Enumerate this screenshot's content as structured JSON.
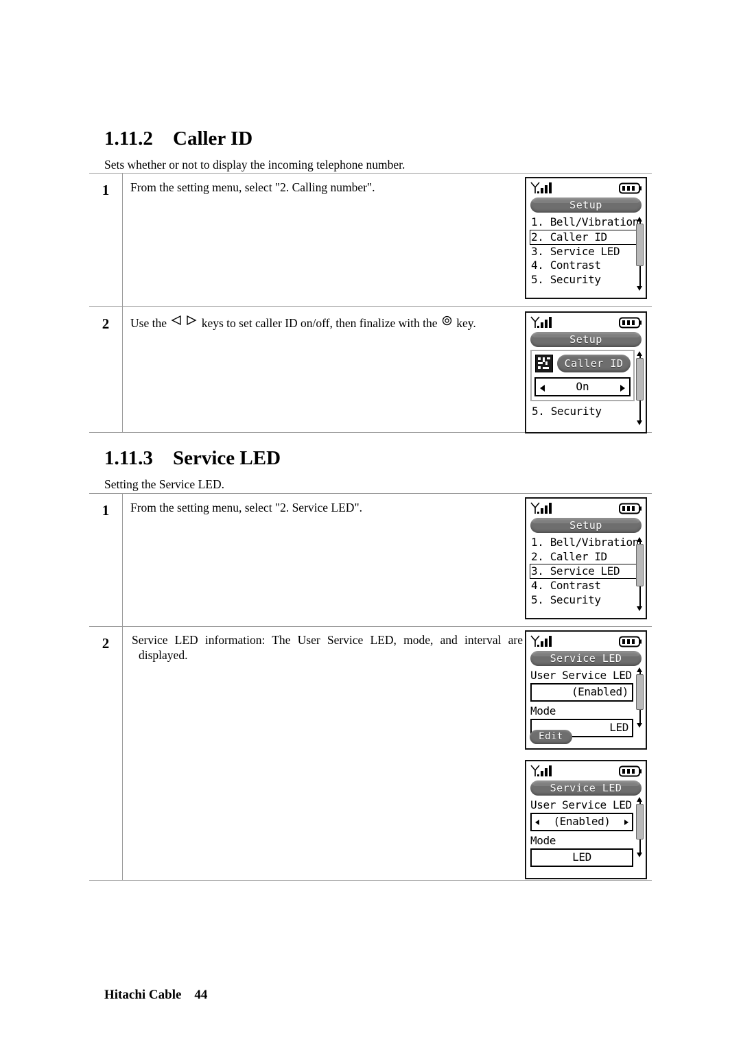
{
  "document": {
    "footer": "Hitachi Cable    44",
    "footer_brand": "Hitachi Cable",
    "footer_page": "44"
  },
  "sections": [
    {
      "number": "1.11.2",
      "title": "Caller ID",
      "intro": "Sets whether or not to display the incoming telephone number.",
      "steps": [
        {
          "num": "1",
          "text": "From the setting menu, select \"2. Calling number\"."
        },
        {
          "num": "2",
          "text_part1": "Use the",
          "icon_left": "left-triangle-key",
          "icon_right": "right-triangle-key",
          "text_part2": "keys to set caller ID on/off, then finalize with the",
          "icon_enter": "circle-enter-key",
          "text_part3": "key."
        }
      ]
    },
    {
      "number": "1.11.3",
      "title": "Service LED",
      "intro": "Setting the Service LED.",
      "steps": [
        {
          "num": "1",
          "text": "From the setting menu, select \"2. Service LED\"."
        },
        {
          "num": "2",
          "text": "Service LED information:  The User Service LED, mode, and interval are displayed."
        }
      ]
    }
  ],
  "screens": [
    {
      "id": "setup-caller-id-highlighted",
      "statusbar": {
        "signal": "signal-bars-icon",
        "battery": "battery-full-icon"
      },
      "title": "Setup",
      "list": [
        {
          "label": "1. Bell/Vibration",
          "selected": false
        },
        {
          "label": "2. Caller ID",
          "selected": true
        },
        {
          "label": "3. Service LED",
          "selected": false
        },
        {
          "label": "4. Contrast",
          "selected": false
        },
        {
          "label": "5. Security",
          "selected": false
        }
      ]
    },
    {
      "id": "setup-caller-id-editor",
      "statusbar": {
        "signal": "signal-bars-icon",
        "battery": "battery-full-icon"
      },
      "title": "Setup",
      "field_icon": "caller-id-glyph-icon",
      "field_label": "Caller ID",
      "field_value": "On",
      "trailing_item": "5. Security"
    },
    {
      "id": "setup-service-led-highlighted",
      "statusbar": {
        "signal": "signal-bars-icon",
        "battery": "battery-full-icon"
      },
      "title": "Setup",
      "list": [
        {
          "label": "1. Bell/Vibration",
          "selected": false
        },
        {
          "label": "2. Caller ID",
          "selected": false
        },
        {
          "label": "3. Service LED",
          "selected": true
        },
        {
          "label": "4. Contrast",
          "selected": false
        },
        {
          "label": "5. Security",
          "selected": false
        }
      ]
    },
    {
      "id": "service-led-info",
      "statusbar": {
        "signal": "signal-bars-icon",
        "battery": "battery-full-icon"
      },
      "title": "Service LED",
      "fields": [
        {
          "label": "User Service LED",
          "value": "(Enabled)"
        },
        {
          "label": "Mode",
          "value": "LED"
        }
      ],
      "softkey": "Edit"
    },
    {
      "id": "service-led-edit",
      "statusbar": {
        "signal": "signal-bars-icon",
        "battery": "battery-full-icon"
      },
      "title": "Service LED",
      "fields": [
        {
          "label": "User Service LED",
          "value": "(Enabled)"
        },
        {
          "label": "Mode",
          "value": "LED"
        }
      ]
    }
  ],
  "colors": {
    "pill_gray": "#6e6e6e",
    "rule_gray": "#9a9a9a",
    "text_black": "#000000",
    "group_border": "#adadad",
    "scroll_thumb": "#b9b9b9"
  }
}
